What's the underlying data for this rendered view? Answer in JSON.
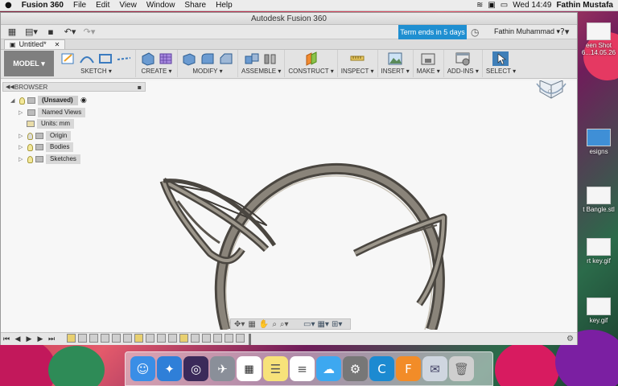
{
  "menubar": {
    "app_name": "Fusion 360",
    "items": [
      "File",
      "Edit",
      "View",
      "Window",
      "Share",
      "Help"
    ],
    "clock": "Wed 14:49",
    "user": "Fathin Mustafa"
  },
  "window": {
    "title": "Autodesk Fusion 360",
    "term_badge": "Term ends in 5 days",
    "account_name": "Fathin Muhammad",
    "doc_tab": "Untitled*"
  },
  "toolbar": {
    "workspace": "MODEL",
    "groups": [
      "SKETCH",
      "CREATE",
      "MODIFY",
      "ASSEMBLE",
      "CONSTRUCT",
      "INSPECT",
      "INSERT",
      "MAKE",
      "ADD-INS",
      "SELECT"
    ]
  },
  "browser": {
    "header": "BROWSER",
    "root": "(Unsaved)",
    "nodes": [
      "Named Views",
      "Units: mm",
      "Origin",
      "Bodies",
      "Sketches"
    ]
  },
  "desktop": {
    "files": [
      "een Shot 6...14.05.26",
      "esigns",
      "t Bangle.stl",
      "rt key.gif",
      "key.gif"
    ]
  },
  "colors": {
    "accent": "#1f8fd1",
    "model_bg": "#7f7f7f",
    "body_stroke": "#4a4640",
    "body_fill": "#8a847a"
  }
}
